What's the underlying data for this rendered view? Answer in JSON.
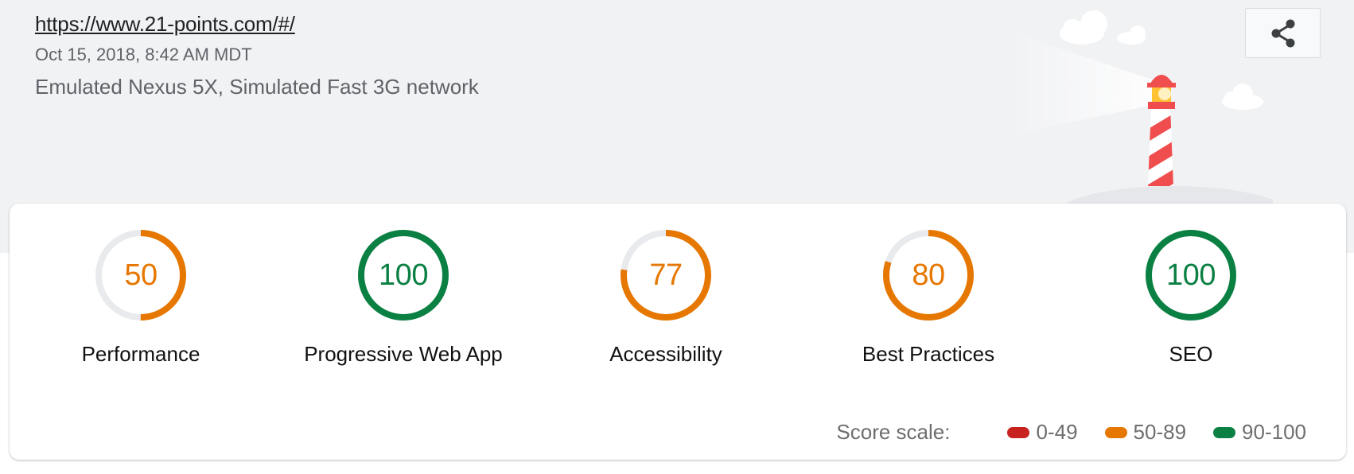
{
  "header": {
    "url": "https://www.21-points.com/#/",
    "date": "Oct 15, 2018, 8:42 AM MDT",
    "device": "Emulated Nexus 5X, Simulated Fast 3G network",
    "share_icon": "share-icon",
    "illustration_icon": "lighthouse-icon"
  },
  "categories": [
    {
      "label": "Performance",
      "score": "50",
      "value": 50,
      "status": "average"
    },
    {
      "label": "Progressive Web App",
      "score": "100",
      "value": 100,
      "status": "pass"
    },
    {
      "label": "Accessibility",
      "score": "77",
      "value": 77,
      "status": "average"
    },
    {
      "label": "Best Practices",
      "score": "80",
      "value": 80,
      "status": "average"
    },
    {
      "label": "SEO",
      "score": "100",
      "value": 100,
      "status": "pass"
    }
  ],
  "scale": {
    "title": "Score scale:",
    "ranges": [
      {
        "label": "0-49",
        "color": "#c7221f"
      },
      {
        "label": "50-89",
        "color": "#e67700"
      },
      {
        "label": "90-100",
        "color": "#0b8043"
      }
    ]
  },
  "colors": {
    "pass": "#0b8043",
    "average": "#e67700",
    "fail": "#c7221f",
    "track": "#e8eaed",
    "header_bg": "#f1f2f4"
  }
}
